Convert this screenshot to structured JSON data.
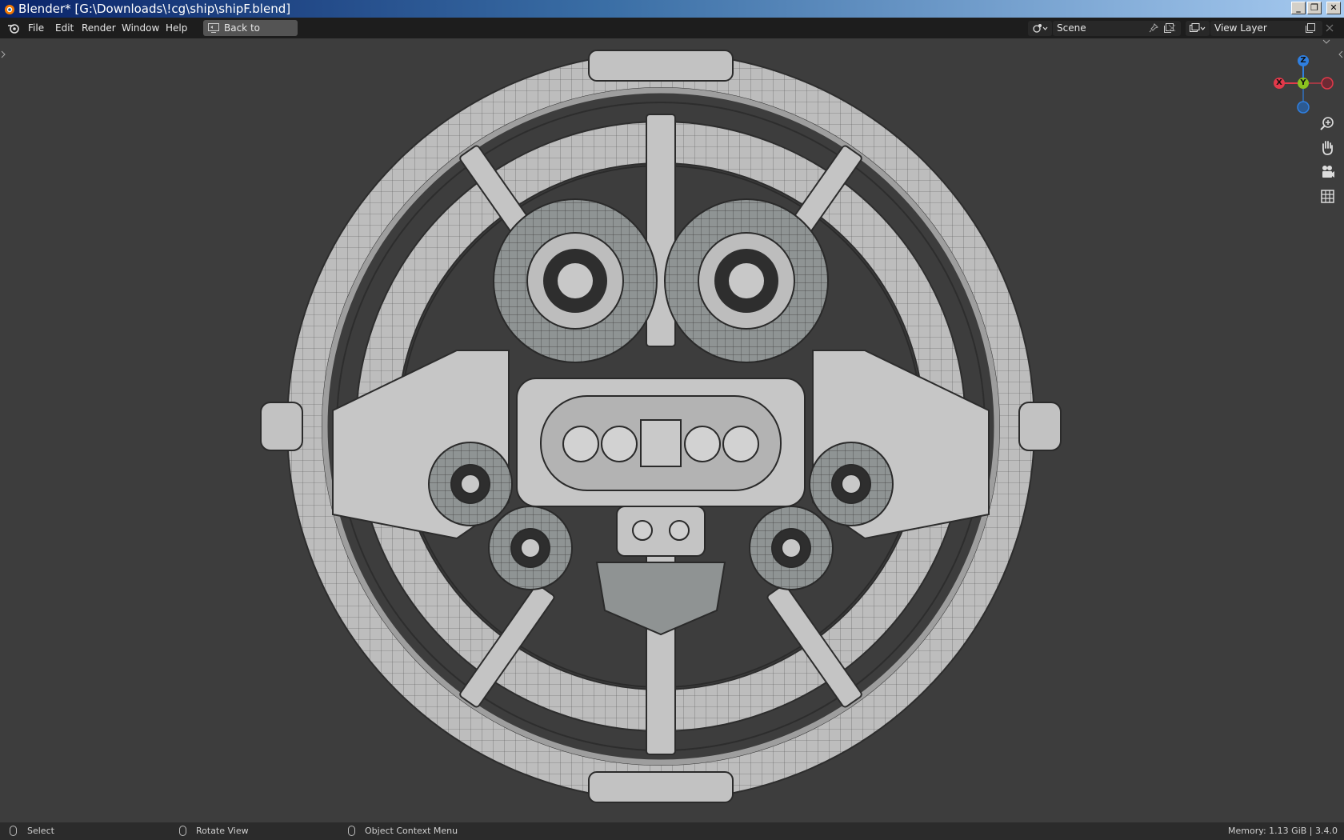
{
  "window": {
    "title": "Blender* [G:\\Downloads\\!cg\\ship\\shipF.blend]",
    "controls": [
      "_",
      "❐",
      "✕"
    ]
  },
  "menu": {
    "items": [
      "File",
      "Edit",
      "Render",
      "Window",
      "Help"
    ],
    "back_button": "Back to Previous",
    "scene_label": "Scene",
    "view_layer_label": "View Layer"
  },
  "gizmo": {
    "z": "Z",
    "x": "X",
    "y": "Y"
  },
  "statusbar": {
    "select": "Select",
    "rotate": "Rotate View",
    "context": "Object Context Menu",
    "memory": "Memory: 1.13 GiB | 3.4.0"
  },
  "colors": {
    "axis_x": "#e2394a",
    "axis_y": "#8bc21f",
    "axis_z": "#2f7fe0",
    "viewport_bg": "#3d3d3d",
    "model": "#b9b9b9"
  },
  "icons": [
    "blender-logo-icon",
    "back-icon",
    "scene-icon",
    "pin-icon",
    "copy-icon",
    "close-icon",
    "view-layer-icon",
    "zoom-icon",
    "hand-icon",
    "camera-icon",
    "grid-icon",
    "mouse-icon"
  ]
}
